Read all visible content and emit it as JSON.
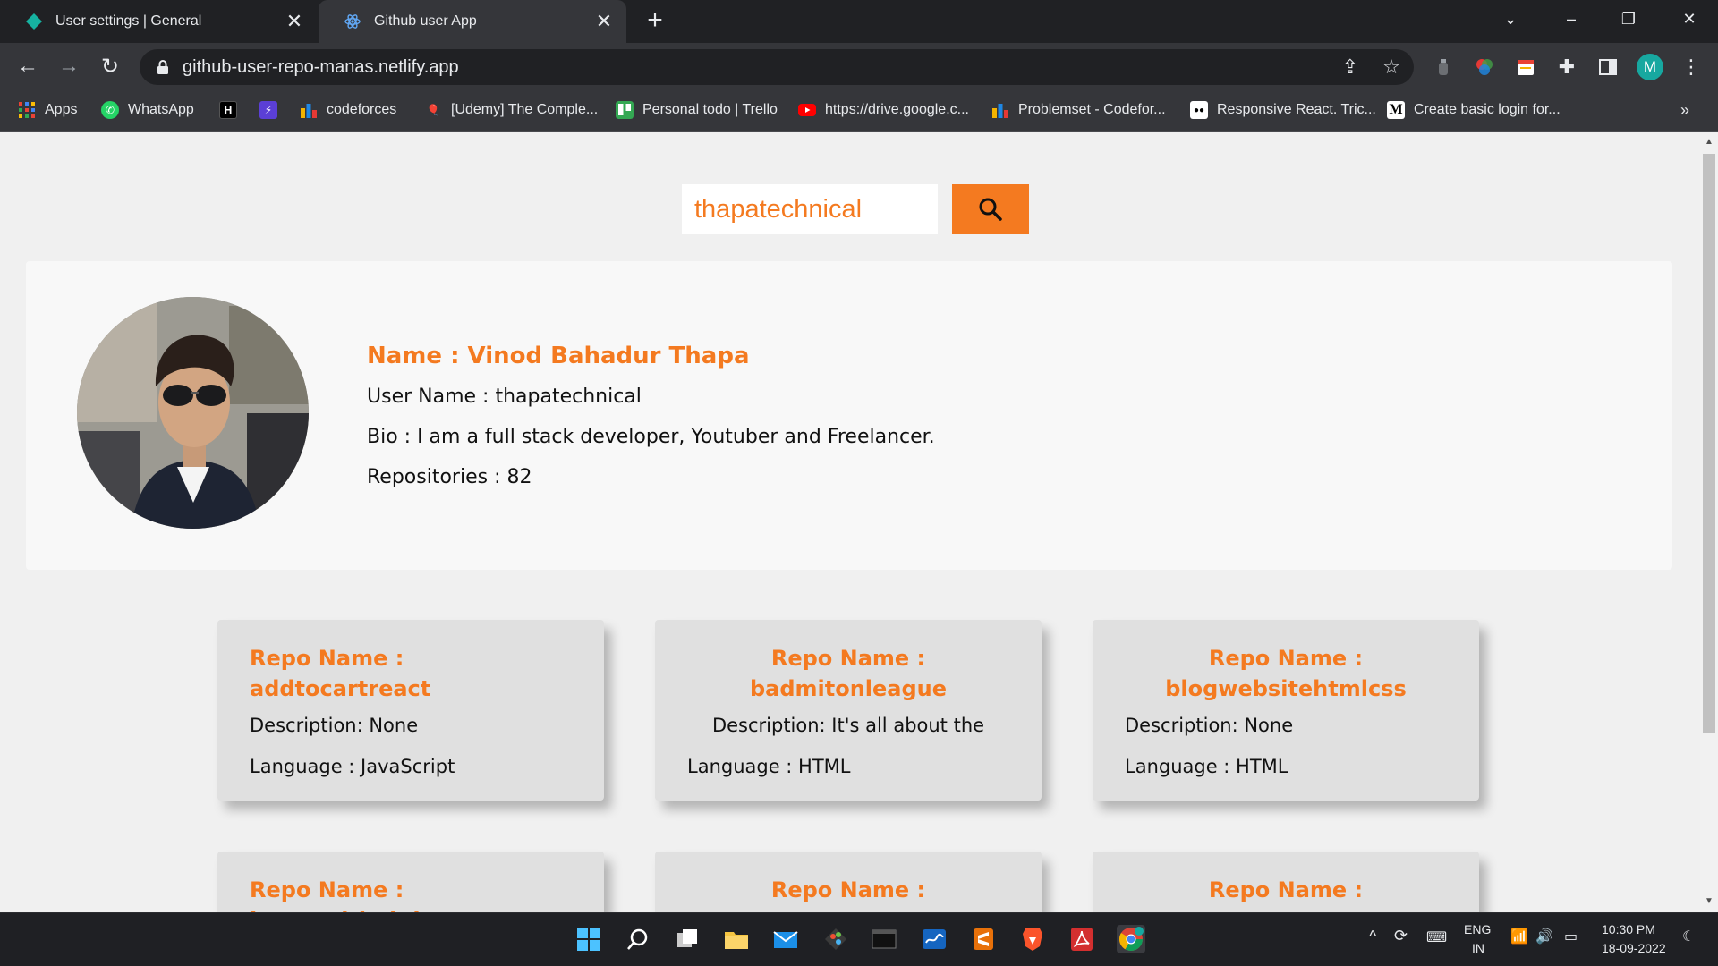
{
  "browser": {
    "tabs": [
      {
        "title": "User settings | General",
        "active": false
      },
      {
        "title": "Github user App",
        "active": true
      }
    ],
    "url": "github-user-repo-manas.netlify.app",
    "profile_initial": "M"
  },
  "bookmarks": [
    {
      "label": "Apps",
      "icon": "apps-grid-icon"
    },
    {
      "label": "WhatsApp",
      "icon": "whatsapp-icon"
    },
    {
      "label": "",
      "icon": "hackernoon-icon"
    },
    {
      "label": "",
      "icon": "bolt-icon"
    },
    {
      "label": "codeforces",
      "icon": "codeforces-icon"
    },
    {
      "label": "[Udemy] The Comple...",
      "icon": "balloon-icon"
    },
    {
      "label": "Personal todo | Trello",
      "icon": "trello-icon"
    },
    {
      "label": "https://drive.google.c...",
      "icon": "youtube-icon"
    },
    {
      "label": "Problemset - Codefor...",
      "icon": "codeforces-icon"
    },
    {
      "label": "Responsive React. Tric...",
      "icon": "medium-icon"
    },
    {
      "label": "Create basic login for...",
      "icon": "medium-m-icon"
    }
  ],
  "search": {
    "value": "thapatechnical"
  },
  "profile": {
    "name": "Name : Vinod Bahadur Thapa",
    "username": "User Name : thapatechnical",
    "bio": "Bio : I am a full stack developer, Youtuber and Freelancer.",
    "repos": "Repositories : 82"
  },
  "repos": [
    {
      "title": "Repo Name : addtocartreact",
      "description": "Description: None",
      "language": "Language : JavaScript"
    },
    {
      "title": "Repo Name : badmitonleague",
      "description": "Description: It's all about the",
      "language": "Language : HTML"
    },
    {
      "title": "Repo Name : blogwebsitehtmlcss",
      "description": "Description: None",
      "language": "Language : HTML"
    },
    {
      "title": "Repo Name : boots.github.io",
      "description": "",
      "language": ""
    },
    {
      "title": "Repo Name :",
      "description": "",
      "language": ""
    },
    {
      "title": "Repo Name :",
      "description": "",
      "language": ""
    }
  ],
  "taskbar": {
    "lang_top": "ENG",
    "lang_bottom": "IN",
    "time": "10:30 PM",
    "date": "18-09-2022"
  },
  "colors": {
    "accent": "#f47a20",
    "chrome_dark": "#202124",
    "chrome_mid": "#35363a"
  }
}
